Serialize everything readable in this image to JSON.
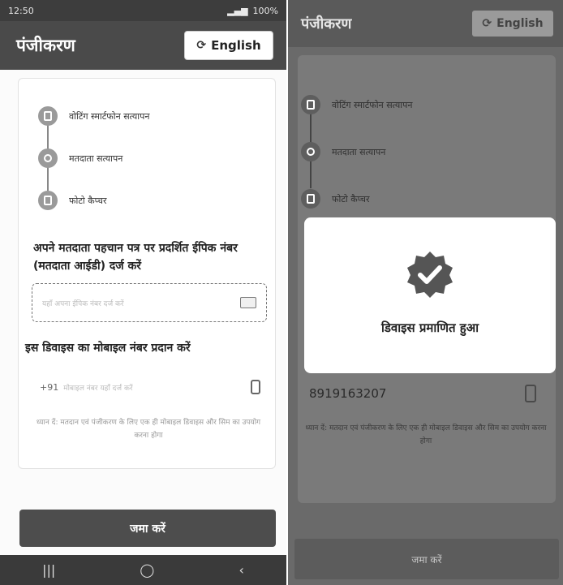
{
  "left": {
    "status_bar": {
      "time": "12:50",
      "battery": "100%"
    },
    "app_title": "पंजीकरण",
    "language_button": "English",
    "steps": [
      {
        "label": "वोटिंग स्मार्टफोन सत्यापन",
        "icon": "smartphone-icon"
      },
      {
        "label": "मतदाता सत्यापन",
        "icon": "voter-icon"
      },
      {
        "label": "फोटो कैप्चर",
        "icon": "photo-icon"
      }
    ],
    "epic_question": "अपने मतदाता पहचान पत्र पर प्रदर्शित ईपिक नंबर (मतदाता आईडी) दर्ज करें",
    "epic_placeholder": "यहाँ अपना ईपिक नंबर दर्ज करें",
    "mobile_question": "इस डिवाइस का मोबाइल नंबर प्रदान करें",
    "mobile_prefix": "+91",
    "mobile_placeholder": "मोबाइल नंबर यहाँ दर्ज करें",
    "note": "ध्यान दें: मतदान एवं पंजीकरण के लिए एक ही मोबाइल डिवाइस और सिम का उपयोग करना होगा",
    "submit_label": "जमा करें",
    "nav": {
      "recent": "|||",
      "home": "◯",
      "back": "‹"
    }
  },
  "right": {
    "app_title": "पंजीकरण",
    "language_button": "English",
    "steps": [
      {
        "label": "वोटिंग स्मार्टफोन सत्यापन"
      },
      {
        "label": "मतदाता सत्यापन"
      },
      {
        "label": "फोटो कैप्चर"
      }
    ],
    "modal_message": "डिवाइस प्रमाणित हुआ",
    "mobile_number": "8919163207",
    "note": "ध्यान दें: मतदान एवं पंजीकरण के लिए एक ही मोबाइल डिवाइस और सिम का उपयोग करना होगा",
    "submit_label": "जमा करें"
  }
}
